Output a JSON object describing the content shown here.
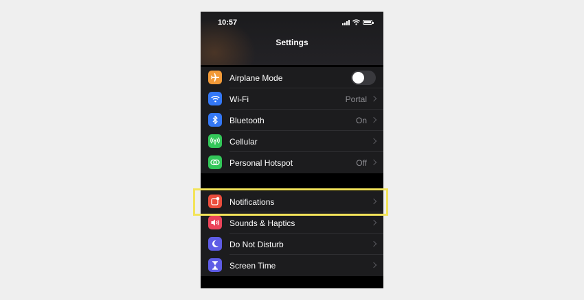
{
  "status_bar": {
    "time": "10:57"
  },
  "header": {
    "title": "Settings"
  },
  "groups": [
    {
      "rows": [
        {
          "label": "Airplane Mode",
          "value": "",
          "icon": "airplane-icon",
          "icon_color": "#f29a38",
          "control": "toggle",
          "toggle_on": false
        },
        {
          "label": "Wi-Fi",
          "value": "Portal",
          "icon": "wifi-icon",
          "icon_color": "#3478f6"
        },
        {
          "label": "Bluetooth",
          "value": "On",
          "icon": "bluetooth-icon",
          "icon_color": "#3478f6"
        },
        {
          "label": "Cellular",
          "value": "",
          "icon": "cellular-icon",
          "icon_color": "#33c759"
        },
        {
          "label": "Personal Hotspot",
          "value": "Off",
          "icon": "hotspot-icon",
          "icon_color": "#33c759"
        }
      ]
    },
    {
      "rows": [
        {
          "label": "Notifications",
          "value": "",
          "icon": "notifications-icon",
          "icon_color": "#eb4d3d"
        },
        {
          "label": "Sounds & Haptics",
          "value": "",
          "icon": "speaker-icon",
          "icon_color": "#eb445a"
        },
        {
          "label": "Do Not Disturb",
          "value": "",
          "icon": "moon-icon",
          "icon_color": "#5e5ce6"
        },
        {
          "label": "Screen Time",
          "value": "",
          "icon": "hourglass-icon",
          "icon_color": "#5e5ce6"
        }
      ]
    }
  ],
  "highlight": {
    "target": "Notifications",
    "color": "#f3e45a"
  }
}
